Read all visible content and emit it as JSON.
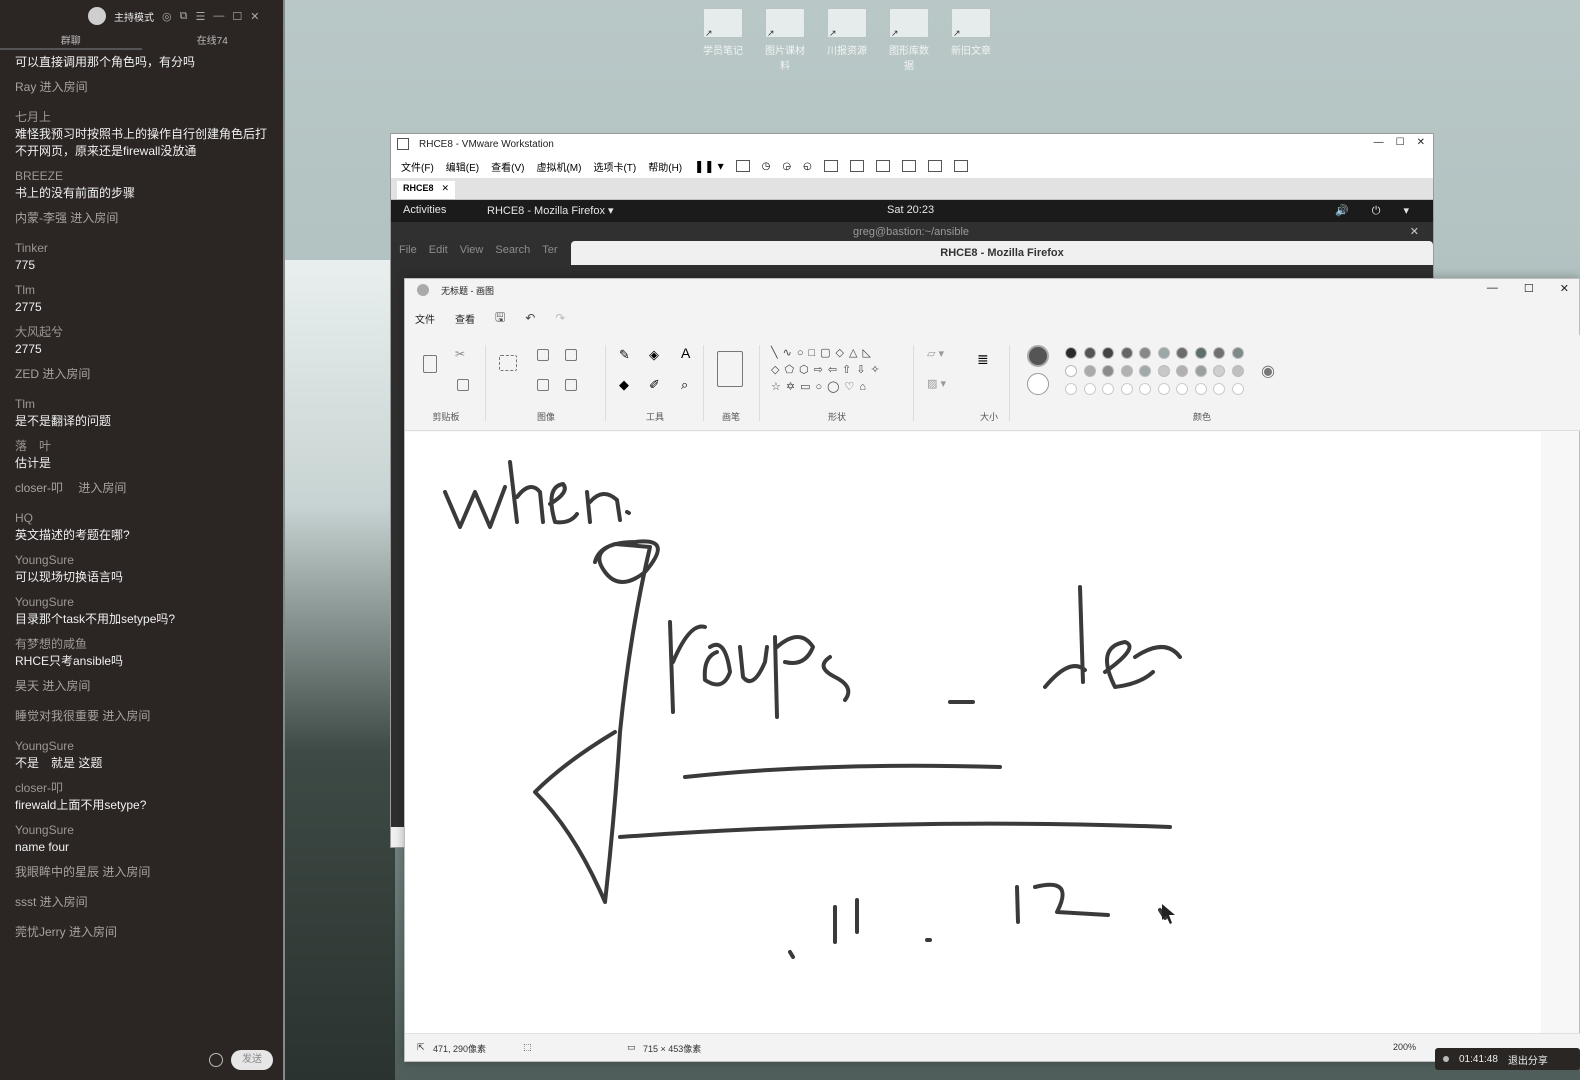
{
  "chat": {
    "mode_label": "主持模式",
    "tabs": [
      "群聊",
      "在线74"
    ],
    "messages": [
      {
        "kind": "text",
        "user": "",
        "text": "可以直接调用那个角色吗，有分吗"
      },
      {
        "kind": "enter",
        "text": "Ray 进入房间"
      },
      {
        "kind": "text",
        "user": "七月上",
        "text": "难怪我预习时按照书上的操作自行创建角色后打不开网页，原来还是firewall没放通"
      },
      {
        "kind": "text",
        "user": "BREEZE",
        "text": "书上的没有前面的步骤"
      },
      {
        "kind": "enter",
        "text": "内蒙-李强 进入房间"
      },
      {
        "kind": "text",
        "user": "Tinker",
        "text": "775"
      },
      {
        "kind": "text",
        "user": "Tlm",
        "text": "2775"
      },
      {
        "kind": "text",
        "user": "大风起兮",
        "text": "2775"
      },
      {
        "kind": "enter",
        "text": "ZED 进入房间"
      },
      {
        "kind": "text",
        "user": "Tlm",
        "text": "是不是翻译的问题"
      },
      {
        "kind": "text",
        "user": "落　叶",
        "text": "估计是"
      },
      {
        "kind": "enter",
        "text": "closer-叩　 进入房间"
      },
      {
        "kind": "text",
        "user": "HQ",
        "text": "英文描述的考题在哪?"
      },
      {
        "kind": "text",
        "user": "YoungSure",
        "text": "可以现场切换语言吗"
      },
      {
        "kind": "text",
        "user": "YoungSure",
        "text": "目录那个task不用加setype吗?"
      },
      {
        "kind": "text",
        "user": "有梦想的咸鱼",
        "text": "RHCE只考ansible吗"
      },
      {
        "kind": "enter",
        "text": "昊天 进入房间"
      },
      {
        "kind": "enter",
        "text": "睡觉对我很重要 进入房间"
      },
      {
        "kind": "text",
        "user": "YoungSure",
        "text": "不是　就是 这题"
      },
      {
        "kind": "text",
        "user": "closer-叩",
        "text": "firewald上面不用setype?"
      },
      {
        "kind": "text",
        "user": "YoungSure",
        "text": "name four"
      },
      {
        "kind": "enter",
        "text": "我眼眸中的星辰 进入房间"
      },
      {
        "kind": "enter",
        "text": "ssst 进入房间"
      },
      {
        "kind": "enter",
        "text": "莞忧Jerry 进入房间"
      }
    ],
    "send_label": "发送"
  },
  "desktop": {
    "icons": [
      "学员笔记",
      "图片课材料",
      "川报资源",
      "图形库数据",
      "新旧文章"
    ]
  },
  "vmware": {
    "title": "RHCE8 - VMware Workstation",
    "menu": [
      "文件(F)",
      "编辑(E)",
      "查看(V)",
      "虚拟机(M)",
      "选项卡(T)",
      "帮助(H)"
    ],
    "tab": "RHCE8",
    "gnome": {
      "activities": "Activities",
      "app": "RHCE8 - Mozilla Firefox ▾",
      "clock": "Sat 20:23",
      "tray": "🔊 ⏻ ▾"
    },
    "terminal_title": "greg@bastion:~/ansible",
    "terminal_menu": [
      "File",
      "Edit",
      "View",
      "Search",
      "Ter"
    ],
    "firefox_title": "RHCE8 - Mozilla Firefox"
  },
  "paint": {
    "title": "无标题 - 画图",
    "menu": [
      "文件",
      "查看"
    ],
    "ribbon_groups": [
      "剪贴板",
      "图像",
      "工具",
      "画笔",
      "形状",
      "大小",
      "颜色"
    ],
    "colors_row1": [
      "#2a2a2a",
      "#555555",
      "#444444",
      "#666666",
      "#888888",
      "#9aa8a8",
      "#6c6c6c",
      "#5f6f6f",
      "#707070",
      "#7f8a8a"
    ],
    "colors_row2": [
      "#ffffff",
      "#aaaaaa",
      "#8a8a8a",
      "#b2b2b2",
      "#a0aaaa",
      "#c8c8c8",
      "#b0b0b0",
      "#9aa0a0",
      "#d0d0d0",
      "#c0c0c0"
    ],
    "status": {
      "cursor": "471, 290像素",
      "size": "715 × 453像素",
      "zoom": "200%"
    }
  },
  "share": {
    "timer": "01:41:48",
    "exit_label": "退出分享"
  }
}
